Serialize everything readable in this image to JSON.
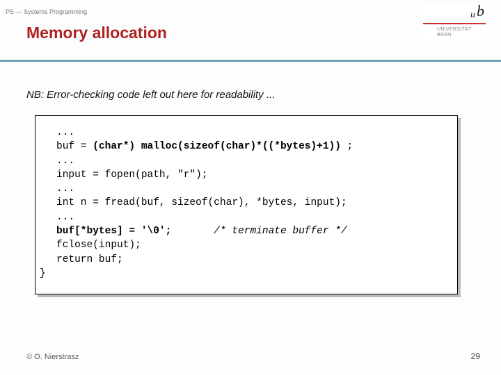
{
  "header": {
    "breadcrumb": "PS — Systems Programming"
  },
  "logo": {
    "u": "u",
    "b": "b",
    "line1": "UNIVERSITÄT",
    "line2": "BERN"
  },
  "title": "Memory allocation",
  "note": "NB: Error-checking code left out here for readability ...",
  "code": {
    "l1": "...",
    "l2a": "buf = ",
    "l2b": "(char*) malloc(sizeof(char)*((*bytes)+1))",
    "l2c": " ;",
    "l3": "...",
    "l4": "input = fopen(path, \"r\");",
    "l5": "...",
    "l6": "int n = fread(buf, sizeof(char), *bytes, input);",
    "l7": "...",
    "l8a": "buf[*bytes] = '\\0';",
    "l8pad": "       ",
    "l8b": "/* terminate buffer */",
    "l9": "fclose(input);",
    "l10": "return buf;",
    "l11": "}"
  },
  "footer": {
    "copyright": "© O. Nierstrasz",
    "page": "29"
  }
}
